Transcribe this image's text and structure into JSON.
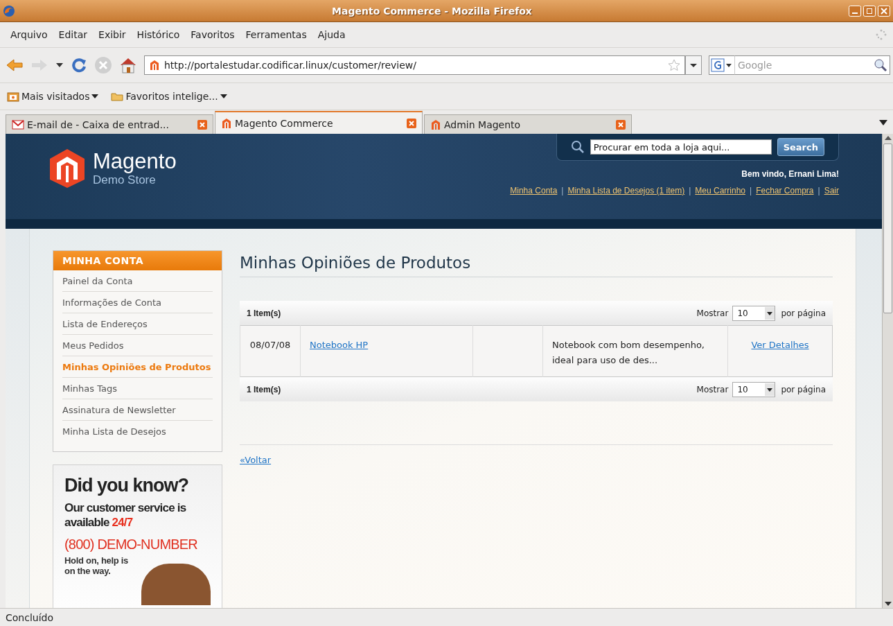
{
  "window": {
    "title": "Magento Commerce - Mozilla Firefox"
  },
  "menu": [
    "Arquivo",
    "Editar",
    "Exibir",
    "Histórico",
    "Favoritos",
    "Ferramentas",
    "Ajuda"
  ],
  "navigation": {
    "url": "http://portalestudar.codificar.linux/customer/review/",
    "search_placeholder": "Google"
  },
  "bookmarks": [
    {
      "label": "Mais visitados",
      "kind": "feed"
    },
    {
      "label": "Favoritos intelige...",
      "kind": "folder"
    }
  ],
  "tabs": [
    {
      "label": "E-mail de  - Caixa de entrad...",
      "kind": "mail",
      "selected": false
    },
    {
      "label": "Magento Commerce",
      "kind": "magento",
      "selected": true
    },
    {
      "label": "Admin Magento",
      "kind": "magento",
      "selected": false
    }
  ],
  "page": {
    "logo": {
      "name": "Magento",
      "subtitle": "Demo Store"
    },
    "search": {
      "placeholder": "Procurar em toda a loja aqui...",
      "button": "Search"
    },
    "welcome": "Bem vindo, Ernani Lima!",
    "header_links": [
      {
        "label": "Minha Conta"
      },
      {
        "separator": "|",
        "label": "Minha Lista de Desejos (1 item)"
      },
      {
        "separator": "|",
        "label": "Meu Carrinho"
      },
      {
        "separator": "|",
        "label": "Fechar Compra"
      },
      {
        "separator": "|",
        "label": "Sair"
      }
    ],
    "sidebar": {
      "title": "MINHA CONTA",
      "items": [
        {
          "label": "Painel da Conta",
          "selected": false
        },
        {
          "label": "Informações de Conta",
          "selected": false
        },
        {
          "label": "Lista de Endereços",
          "selected": false
        },
        {
          "label": "Meus Pedidos",
          "selected": false
        },
        {
          "label": "Minhas Opiniões de Produtos",
          "selected": true
        },
        {
          "label": "Minhas Tags",
          "selected": false
        },
        {
          "label": "Assinatura de Newsletter",
          "selected": false
        },
        {
          "label": "Minha Lista de Desejos",
          "selected": false
        }
      ]
    },
    "promo": {
      "heading": "Did you know?",
      "line": "Our customer service is available **24/7**",
      "phone": "(800) DEMO-NUMBER",
      "note": "Hold on, help is on the way."
    },
    "title": "Minhas Opiniões de Produtos",
    "toolbars": [
      {
        "count": "1 Item(s)",
        "show": "Mostrar",
        "per_page": "10",
        "suffix": "por página"
      },
      {
        "count": "1 Item(s)",
        "show": "Mostrar",
        "per_page": "10",
        "suffix": "por página"
      }
    ],
    "rows": [
      {
        "date": "08/07/08",
        "product": "Notebook HP",
        "review": "Notebook com bom desempenho, ideal para uso de des...",
        "action": "Ver Detalhes"
      }
    ],
    "back": "«Voltar"
  },
  "status_bar": "Concluído"
}
